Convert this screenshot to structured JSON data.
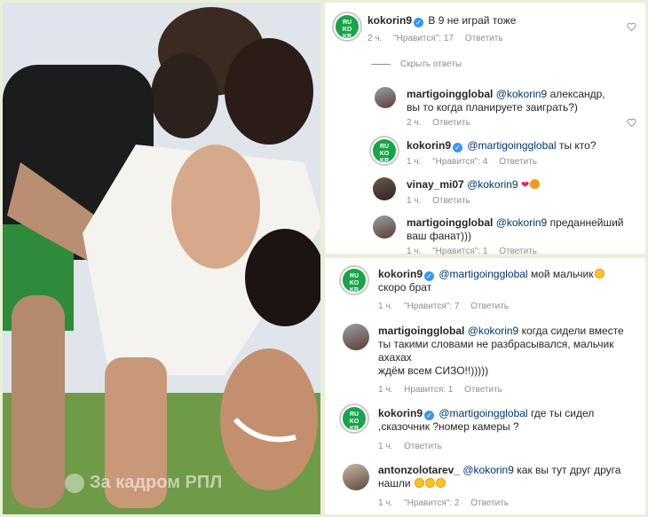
{
  "photo": {
    "watermark": "За кадром РПЛ"
  },
  "panel1": {
    "comments": [
      {
        "user": "kokorin9",
        "verified": true,
        "mention": "",
        "text": "В 9 не играй тоже",
        "time": "2 ч.",
        "likes": "\"Нравится\": 17",
        "reply": "Ответить"
      },
      {
        "user": "martigoingglobal",
        "verified": false,
        "mention": "@kokorin9",
        "text": "александр, вы то когда планируете заиграть?)",
        "time": "2 ч.",
        "likes": "",
        "reply": "Ответить"
      },
      {
        "user": "kokorin9",
        "verified": true,
        "mention": "@martigoingglobal",
        "text": "ты кто?",
        "time": "1 ч.",
        "likes": "\"Нравится\": 4",
        "reply": "Ответить"
      },
      {
        "user": "vinay_mi07",
        "verified": false,
        "mention": "@kokorin9",
        "text": "",
        "time": "1 ч.",
        "likes": "",
        "reply": "Ответить"
      },
      {
        "user": "martigoingglobal",
        "verified": false,
        "mention": "@kokorin9",
        "text": "преданнейший ваш фанат)))",
        "time": "1 ч.",
        "likes": "\"Нравится\": 1",
        "reply": "Ответить"
      }
    ],
    "hide_replies": "Скрыть ответы"
  },
  "panel2": {
    "comments": [
      {
        "user": "kokorin9",
        "verified": true,
        "mention": "@martigoingglobal",
        "text": "мой мальчик",
        "text2": "скоро брат",
        "time": "1 ч.",
        "likes": "\"Нравится\": 7",
        "reply": "Ответить"
      },
      {
        "user": "martigoingglobal",
        "verified": false,
        "mention": "@kokorin9",
        "text": "когда сидели вместе",
        "text2": "ты такими словами не разбрасывался, мальчик",
        "text3": "ахахах",
        "text4": "ждём всем СИЗО!!)))))",
        "time": "1 ч.",
        "likes": "Нравится: 1",
        "reply": "Ответить"
      },
      {
        "user": "kokorin9",
        "verified": true,
        "mention": "@martigoingglobal",
        "text": "где ты сидел",
        "text2": ",сказочник ?номер камеры ?",
        "time": "1 ч.",
        "likes": "",
        "reply": "Ответить"
      },
      {
        "user": "antonzolotarev_",
        "verified": false,
        "mention": "@kokorin9",
        "text": "как вы тут друг друга",
        "text2": "нашли",
        "time": "1 ч.",
        "likes": "\"Нравится\": 2",
        "reply": "Ответить"
      }
    ]
  }
}
